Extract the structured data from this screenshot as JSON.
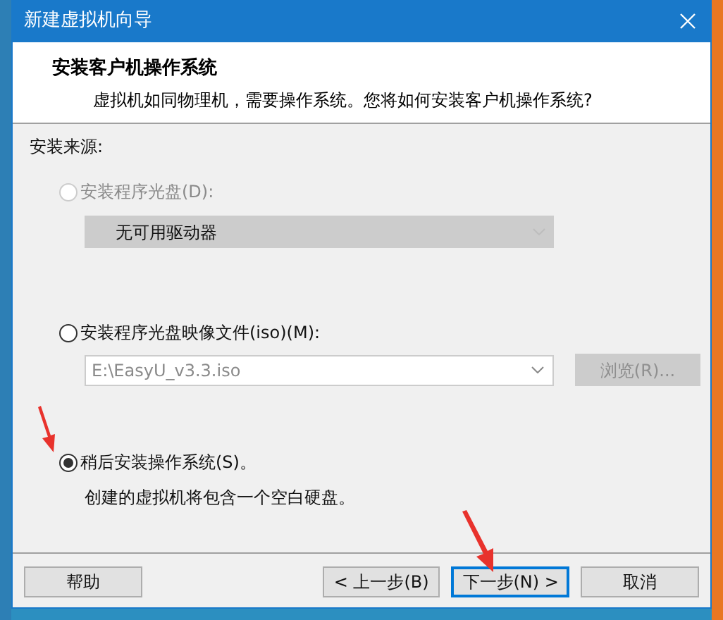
{
  "window": {
    "title": "新建虚拟机向导"
  },
  "header": {
    "title": "安装客户机操作系统",
    "subtitle": "虚拟机如同物理机，需要操作系统。您将如何安装客户机操作系统?"
  },
  "source_label": "安装来源:",
  "options": [
    {
      "kind": "drive",
      "label": "安装程序光盘(D):",
      "selected": false,
      "disabled": true,
      "drive": {
        "value": "无可用驱动器",
        "disabled": true
      }
    },
    {
      "kind": "image",
      "label": "安装程序光盘映像文件(iso)(M):",
      "selected": false,
      "disabled": false,
      "path": {
        "value": "E:\\EasyU_v3.3.iso",
        "disabled": true
      },
      "browse": {
        "label": "浏览(R)...",
        "disabled": true
      }
    },
    {
      "kind": "later",
      "label": "稍后安装操作系统(S)。",
      "selected": true,
      "disabled": false,
      "note": "创建的虚拟机将包含一个空白硬盘。"
    }
  ],
  "buttons": [
    {
      "label": "帮助",
      "focused": false
    },
    {
      "label": "< 上一步(B)",
      "focused": false
    },
    {
      "label": "下一步(N) >",
      "focused": true
    },
    {
      "label": "取消",
      "focused": false
    }
  ]
}
